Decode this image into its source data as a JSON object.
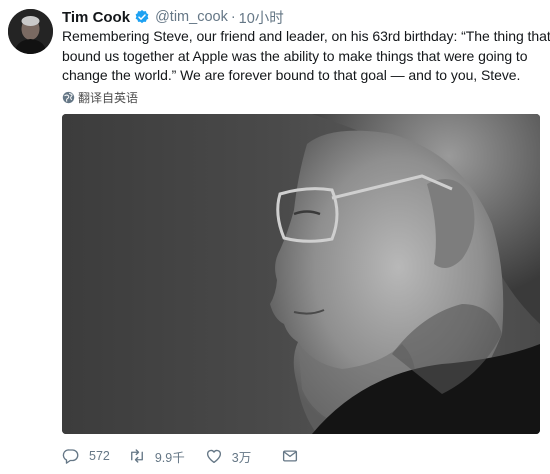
{
  "user": {
    "name": "Tim Cook",
    "handle": "@tim_cook",
    "separator": "·",
    "time": "10小时"
  },
  "tweet": {
    "lines": [
      "Remembering Steve, our friend and leader, on his 63rd birthday: “The thing that",
      "bound us together at Apple was the ability to make things that were going to",
      "change the world.” We are forever bound to that goal — and to you, Steve."
    ],
    "translate_label": "翻译自英语"
  },
  "actions": {
    "reply_count": "572",
    "retweet_count": "9.9千",
    "like_count": "3万"
  },
  "colors": {
    "verified": "#1da1f2",
    "secondary_text": "#657786"
  },
  "icons": [
    "verified-badge-icon",
    "globe-icon",
    "reply-icon",
    "retweet-icon",
    "like-icon",
    "message-icon"
  ]
}
